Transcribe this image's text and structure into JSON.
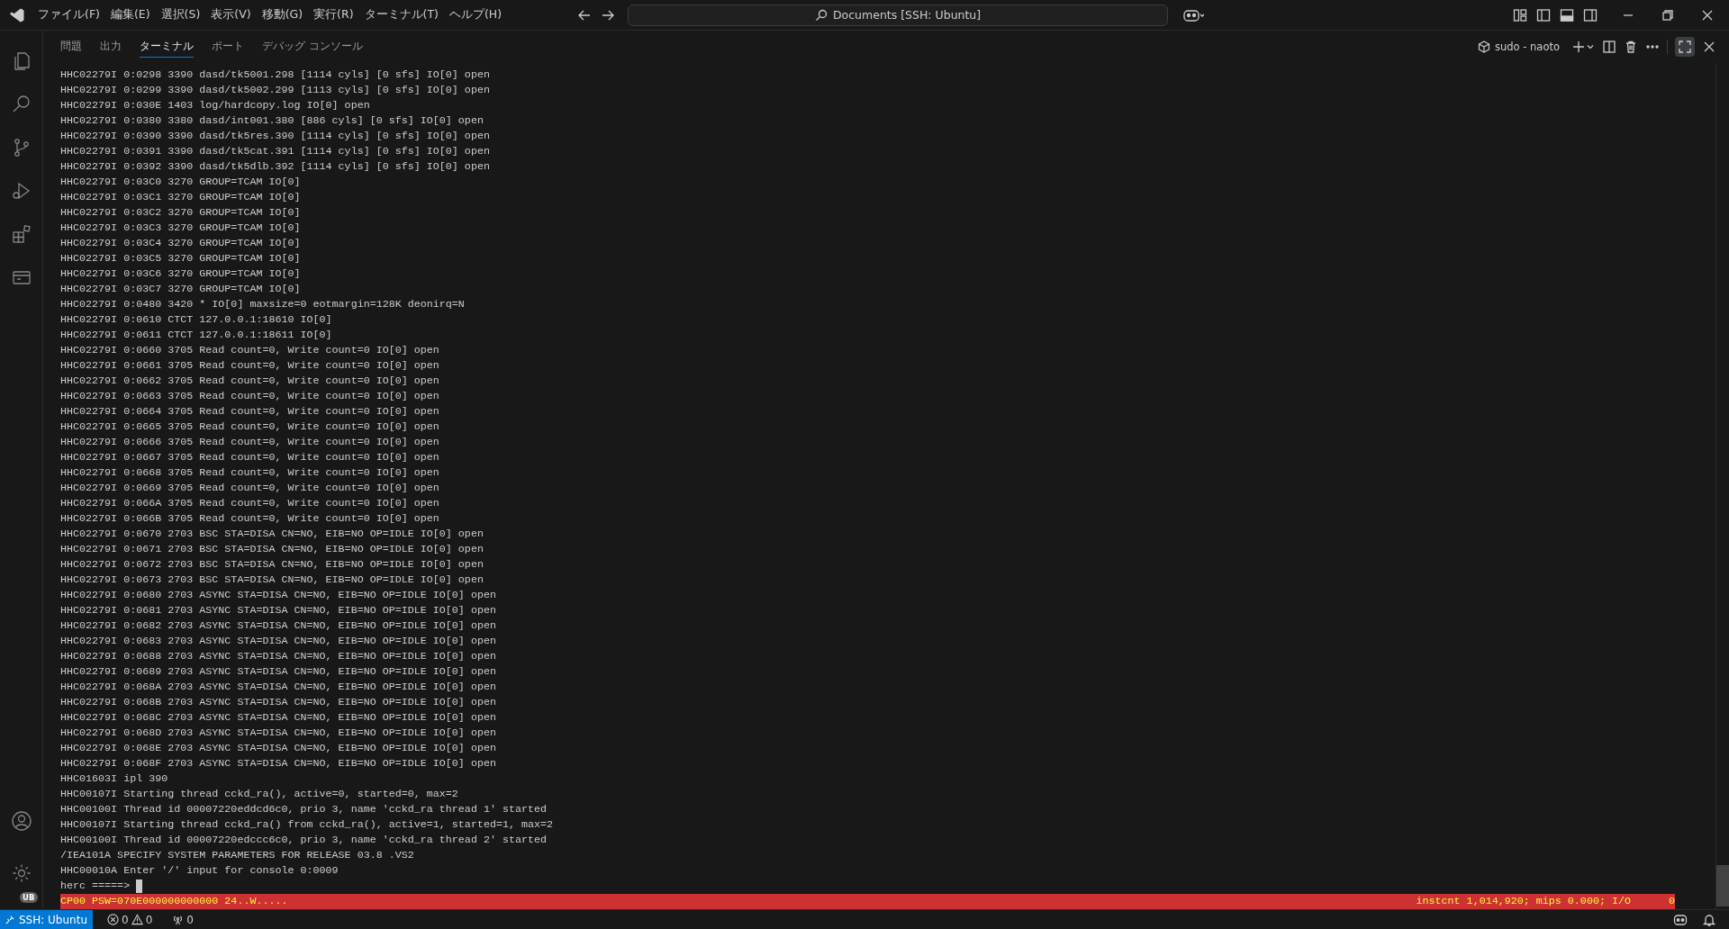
{
  "title_bar": {
    "menus": [
      {
        "label": "ファイル(F)"
      },
      {
        "label": "編集(E)"
      },
      {
        "label": "選択(S)"
      },
      {
        "label": "表示(V)"
      },
      {
        "label": "移動(G)"
      },
      {
        "label": "実行(R)"
      },
      {
        "label": "ターミナル(T)"
      },
      {
        "label": "ヘルプ(H)"
      }
    ],
    "search": {
      "value": "Documents [SSH: Ubuntu]"
    }
  },
  "activity_bar": {
    "account_badge": "UB"
  },
  "panel": {
    "tabs": [
      {
        "label": "問題",
        "selected": false
      },
      {
        "label": "出力",
        "selected": false
      },
      {
        "label": "ターミナル",
        "selected": true
      },
      {
        "label": "ポート",
        "selected": false
      },
      {
        "label": "デバッグ コンソール",
        "selected": false
      }
    ],
    "terminal_name": "sudo - naoto"
  },
  "terminal": {
    "lines": [
      "HHC02279I 0:0298 3390 dasd/tk5001.298 [1114 cyls] [0 sfs] IO[0] open",
      "HHC02279I 0:0299 3390 dasd/tk5002.299 [1113 cyls] [0 sfs] IO[0] open",
      "HHC02279I 0:030E 1403 log/hardcopy.log IO[0] open",
      "HHC02279I 0:0380 3380 dasd/int001.380 [886 cyls] [0 sfs] IO[0] open",
      "HHC02279I 0:0390 3390 dasd/tk5res.390 [1114 cyls] [0 sfs] IO[0] open",
      "HHC02279I 0:0391 3390 dasd/tk5cat.391 [1114 cyls] [0 sfs] IO[0] open",
      "HHC02279I 0:0392 3390 dasd/tk5dlb.392 [1114 cyls] [0 sfs] IO[0] open",
      "HHC02279I 0:03C0 3270 GROUP=TCAM IO[0]",
      "HHC02279I 0:03C1 3270 GROUP=TCAM IO[0]",
      "HHC02279I 0:03C2 3270 GROUP=TCAM IO[0]",
      "HHC02279I 0:03C3 3270 GROUP=TCAM IO[0]",
      "HHC02279I 0:03C4 3270 GROUP=TCAM IO[0]",
      "HHC02279I 0:03C5 3270 GROUP=TCAM IO[0]",
      "HHC02279I 0:03C6 3270 GROUP=TCAM IO[0]",
      "HHC02279I 0:03C7 3270 GROUP=TCAM IO[0]",
      "HHC02279I 0:0480 3420 * IO[0] maxsize=0 eotmargin=128K deonirq=N",
      "HHC02279I 0:0610 CTCT 127.0.0.1:18610 IO[0]",
      "HHC02279I 0:0611 CTCT 127.0.0.1:18611 IO[0]",
      "HHC02279I 0:0660 3705 Read count=0, Write count=0 IO[0] open",
      "HHC02279I 0:0661 3705 Read count=0, Write count=0 IO[0] open",
      "HHC02279I 0:0662 3705 Read count=0, Write count=0 IO[0] open",
      "HHC02279I 0:0663 3705 Read count=0, Write count=0 IO[0] open",
      "HHC02279I 0:0664 3705 Read count=0, Write count=0 IO[0] open",
      "HHC02279I 0:0665 3705 Read count=0, Write count=0 IO[0] open",
      "HHC02279I 0:0666 3705 Read count=0, Write count=0 IO[0] open",
      "HHC02279I 0:0667 3705 Read count=0, Write count=0 IO[0] open",
      "HHC02279I 0:0668 3705 Read count=0, Write count=0 IO[0] open",
      "HHC02279I 0:0669 3705 Read count=0, Write count=0 IO[0] open",
      "HHC02279I 0:066A 3705 Read count=0, Write count=0 IO[0] open",
      "HHC02279I 0:066B 3705 Read count=0, Write count=0 IO[0] open",
      "HHC02279I 0:0670 2703 BSC STA=DISA CN=NO, EIB=NO OP=IDLE IO[0] open",
      "HHC02279I 0:0671 2703 BSC STA=DISA CN=NO, EIB=NO OP=IDLE IO[0] open",
      "HHC02279I 0:0672 2703 BSC STA=DISA CN=NO, EIB=NO OP=IDLE IO[0] open",
      "HHC02279I 0:0673 2703 BSC STA=DISA CN=NO, EIB=NO OP=IDLE IO[0] open",
      "HHC02279I 0:0680 2703 ASYNC STA=DISA CN=NO, EIB=NO OP=IDLE IO[0] open",
      "HHC02279I 0:0681 2703 ASYNC STA=DISA CN=NO, EIB=NO OP=IDLE IO[0] open",
      "HHC02279I 0:0682 2703 ASYNC STA=DISA CN=NO, EIB=NO OP=IDLE IO[0] open",
      "HHC02279I 0:0683 2703 ASYNC STA=DISA CN=NO, EIB=NO OP=IDLE IO[0] open",
      "HHC02279I 0:0688 2703 ASYNC STA=DISA CN=NO, EIB=NO OP=IDLE IO[0] open",
      "HHC02279I 0:0689 2703 ASYNC STA=DISA CN=NO, EIB=NO OP=IDLE IO[0] open",
      "HHC02279I 0:068A 2703 ASYNC STA=DISA CN=NO, EIB=NO OP=IDLE IO[0] open",
      "HHC02279I 0:068B 2703 ASYNC STA=DISA CN=NO, EIB=NO OP=IDLE IO[0] open",
      "HHC02279I 0:068C 2703 ASYNC STA=DISA CN=NO, EIB=NO OP=IDLE IO[0] open",
      "HHC02279I 0:068D 2703 ASYNC STA=DISA CN=NO, EIB=NO OP=IDLE IO[0] open",
      "HHC02279I 0:068E 2703 ASYNC STA=DISA CN=NO, EIB=NO OP=IDLE IO[0] open",
      "HHC02279I 0:068F 2703 ASYNC STA=DISA CN=NO, EIB=NO OP=IDLE IO[0] open",
      "HHC01603I ipl 390",
      "HHC00107I Starting thread cckd_ra(), active=0, started=0, max=2",
      "HHC00100I Thread id 00007220eddcd6c0, prio 3, name 'cckd_ra thread 1' started",
      "HHC00107I Starting thread cckd_ra() from cckd_ra(), active=1, started=1, max=2",
      "HHC00100I Thread id 00007220edccc6c0, prio 3, name 'cckd_ra thread 2' started",
      "/IEA101A SPECIFY SYSTEM PARAMETERS FOR RELEASE 03.8 .VS2",
      "HHC00010A Enter '/' input for console 0:0009"
    ],
    "prompt": "herc =====>",
    "cpu_status": {
      "left": "CP00 PSW=070E000000000000 24..W.....",
      "right": "instcnt 1,014,920; mips 0.000; I/O",
      "io_count": "0"
    }
  },
  "status_bar": {
    "remote": "SSH: Ubuntu",
    "errors": "0",
    "warnings": "0",
    "ports": "0"
  }
}
